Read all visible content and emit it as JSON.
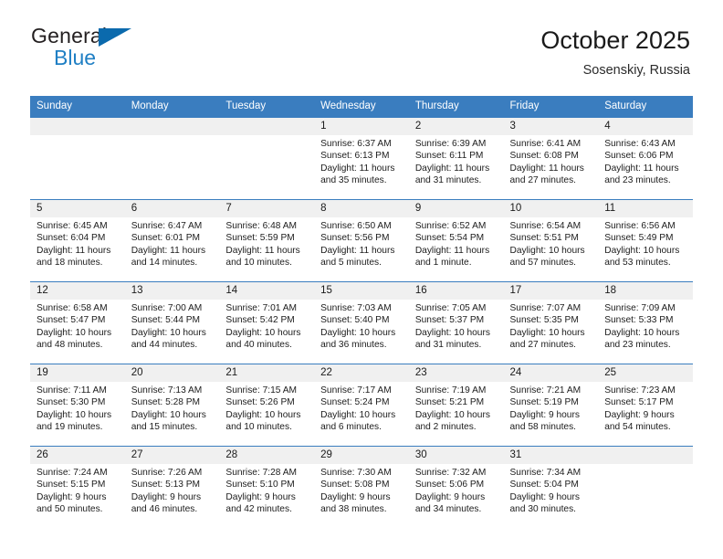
{
  "brand": {
    "name_top": "General",
    "name_bottom": "Blue",
    "colors": {
      "dark": "#231f20",
      "blue": "#1f7fc4",
      "triangle": "#0b6aad"
    }
  },
  "header": {
    "title": "October 2025",
    "location": "Sosenskiy, Russia"
  },
  "theme": {
    "header_row_bg": "#3a7dbf",
    "daynum_bg": "#f0f0f0",
    "grid_line": "#3a7dbf",
    "page_bg": "#ffffff"
  },
  "weekdays": [
    "Sunday",
    "Monday",
    "Tuesday",
    "Wednesday",
    "Thursday",
    "Friday",
    "Saturday"
  ],
  "weeks": [
    [
      {
        "day": "",
        "sunrise": "",
        "sunset": "",
        "daylight": "",
        "blank": true
      },
      {
        "day": "",
        "sunrise": "",
        "sunset": "",
        "daylight": "",
        "blank": true
      },
      {
        "day": "",
        "sunrise": "",
        "sunset": "",
        "daylight": "",
        "blank": true
      },
      {
        "day": "1",
        "sunrise": "Sunrise: 6:37 AM",
        "sunset": "Sunset: 6:13 PM",
        "daylight": "Daylight: 11 hours and 35 minutes."
      },
      {
        "day": "2",
        "sunrise": "Sunrise: 6:39 AM",
        "sunset": "Sunset: 6:11 PM",
        "daylight": "Daylight: 11 hours and 31 minutes."
      },
      {
        "day": "3",
        "sunrise": "Sunrise: 6:41 AM",
        "sunset": "Sunset: 6:08 PM",
        "daylight": "Daylight: 11 hours and 27 minutes."
      },
      {
        "day": "4",
        "sunrise": "Sunrise: 6:43 AM",
        "sunset": "Sunset: 6:06 PM",
        "daylight": "Daylight: 11 hours and 23 minutes."
      }
    ],
    [
      {
        "day": "5",
        "sunrise": "Sunrise: 6:45 AM",
        "sunset": "Sunset: 6:04 PM",
        "daylight": "Daylight: 11 hours and 18 minutes."
      },
      {
        "day": "6",
        "sunrise": "Sunrise: 6:47 AM",
        "sunset": "Sunset: 6:01 PM",
        "daylight": "Daylight: 11 hours and 14 minutes."
      },
      {
        "day": "7",
        "sunrise": "Sunrise: 6:48 AM",
        "sunset": "Sunset: 5:59 PM",
        "daylight": "Daylight: 11 hours and 10 minutes."
      },
      {
        "day": "8",
        "sunrise": "Sunrise: 6:50 AM",
        "sunset": "Sunset: 5:56 PM",
        "daylight": "Daylight: 11 hours and 5 minutes."
      },
      {
        "day": "9",
        "sunrise": "Sunrise: 6:52 AM",
        "sunset": "Sunset: 5:54 PM",
        "daylight": "Daylight: 11 hours and 1 minute."
      },
      {
        "day": "10",
        "sunrise": "Sunrise: 6:54 AM",
        "sunset": "Sunset: 5:51 PM",
        "daylight": "Daylight: 10 hours and 57 minutes."
      },
      {
        "day": "11",
        "sunrise": "Sunrise: 6:56 AM",
        "sunset": "Sunset: 5:49 PM",
        "daylight": "Daylight: 10 hours and 53 minutes."
      }
    ],
    [
      {
        "day": "12",
        "sunrise": "Sunrise: 6:58 AM",
        "sunset": "Sunset: 5:47 PM",
        "daylight": "Daylight: 10 hours and 48 minutes."
      },
      {
        "day": "13",
        "sunrise": "Sunrise: 7:00 AM",
        "sunset": "Sunset: 5:44 PM",
        "daylight": "Daylight: 10 hours and 44 minutes."
      },
      {
        "day": "14",
        "sunrise": "Sunrise: 7:01 AM",
        "sunset": "Sunset: 5:42 PM",
        "daylight": "Daylight: 10 hours and 40 minutes."
      },
      {
        "day": "15",
        "sunrise": "Sunrise: 7:03 AM",
        "sunset": "Sunset: 5:40 PM",
        "daylight": "Daylight: 10 hours and 36 minutes."
      },
      {
        "day": "16",
        "sunrise": "Sunrise: 7:05 AM",
        "sunset": "Sunset: 5:37 PM",
        "daylight": "Daylight: 10 hours and 31 minutes."
      },
      {
        "day": "17",
        "sunrise": "Sunrise: 7:07 AM",
        "sunset": "Sunset: 5:35 PM",
        "daylight": "Daylight: 10 hours and 27 minutes."
      },
      {
        "day": "18",
        "sunrise": "Sunrise: 7:09 AM",
        "sunset": "Sunset: 5:33 PM",
        "daylight": "Daylight: 10 hours and 23 minutes."
      }
    ],
    [
      {
        "day": "19",
        "sunrise": "Sunrise: 7:11 AM",
        "sunset": "Sunset: 5:30 PM",
        "daylight": "Daylight: 10 hours and 19 minutes."
      },
      {
        "day": "20",
        "sunrise": "Sunrise: 7:13 AM",
        "sunset": "Sunset: 5:28 PM",
        "daylight": "Daylight: 10 hours and 15 minutes."
      },
      {
        "day": "21",
        "sunrise": "Sunrise: 7:15 AM",
        "sunset": "Sunset: 5:26 PM",
        "daylight": "Daylight: 10 hours and 10 minutes."
      },
      {
        "day": "22",
        "sunrise": "Sunrise: 7:17 AM",
        "sunset": "Sunset: 5:24 PM",
        "daylight": "Daylight: 10 hours and 6 minutes."
      },
      {
        "day": "23",
        "sunrise": "Sunrise: 7:19 AM",
        "sunset": "Sunset: 5:21 PM",
        "daylight": "Daylight: 10 hours and 2 minutes."
      },
      {
        "day": "24",
        "sunrise": "Sunrise: 7:21 AM",
        "sunset": "Sunset: 5:19 PM",
        "daylight": "Daylight: 9 hours and 58 minutes."
      },
      {
        "day": "25",
        "sunrise": "Sunrise: 7:23 AM",
        "sunset": "Sunset: 5:17 PM",
        "daylight": "Daylight: 9 hours and 54 minutes."
      }
    ],
    [
      {
        "day": "26",
        "sunrise": "Sunrise: 7:24 AM",
        "sunset": "Sunset: 5:15 PM",
        "daylight": "Daylight: 9 hours and 50 minutes."
      },
      {
        "day": "27",
        "sunrise": "Sunrise: 7:26 AM",
        "sunset": "Sunset: 5:13 PM",
        "daylight": "Daylight: 9 hours and 46 minutes."
      },
      {
        "day": "28",
        "sunrise": "Sunrise: 7:28 AM",
        "sunset": "Sunset: 5:10 PM",
        "daylight": "Daylight: 9 hours and 42 minutes."
      },
      {
        "day": "29",
        "sunrise": "Sunrise: 7:30 AM",
        "sunset": "Sunset: 5:08 PM",
        "daylight": "Daylight: 9 hours and 38 minutes."
      },
      {
        "day": "30",
        "sunrise": "Sunrise: 7:32 AM",
        "sunset": "Sunset: 5:06 PM",
        "daylight": "Daylight: 9 hours and 34 minutes."
      },
      {
        "day": "31",
        "sunrise": "Sunrise: 7:34 AM",
        "sunset": "Sunset: 5:04 PM",
        "daylight": "Daylight: 9 hours and 30 minutes."
      },
      {
        "day": "",
        "sunrise": "",
        "sunset": "",
        "daylight": "",
        "blank": true
      }
    ]
  ]
}
